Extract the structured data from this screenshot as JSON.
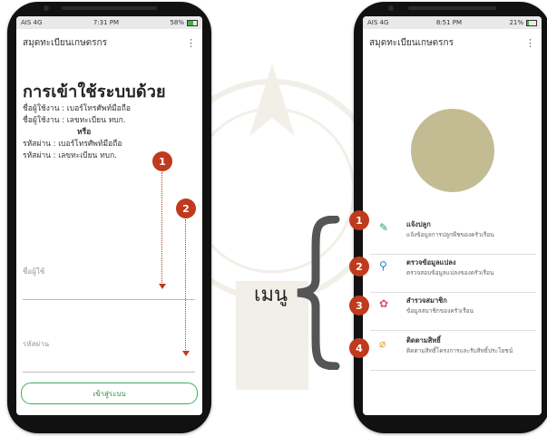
{
  "left_phone": {
    "status": {
      "carrier": "AIS 4G",
      "time": "7:31 PM",
      "battery": "58%",
      "battery_level": 0.58
    },
    "app_title": "สมุดทะเบียนเกษตรกร",
    "login_title": "การเข้าใช้ระบบด้วย",
    "info_lines": {
      "user1": "ชื่อผู้ใช้งาน : เบอร์โทรศัพท์มือถือ",
      "user2": "ชื่อผู้ใช้งาน : เลขทะเบียน ทบก.",
      "or": "หรือ",
      "pass1": "รหัสผ่าน : เบอร์โทรศัพท์มือถือ",
      "pass2": "รหัสผ่าน : เลขทะเบียน ทบก."
    },
    "username_label": "ชื่อผู้ใช้",
    "password_label": "รหัสผ่าน",
    "login_button": "เข้าสู่ระบบ",
    "badge1": "1",
    "badge2": "2"
  },
  "right_phone": {
    "status": {
      "carrier": "AIS 4G",
      "time": "8:51 PM",
      "battery": "21%",
      "battery_level": 0.21
    },
    "app_title": "สมุดทะเบียนเกษตรกร",
    "menu_items": [
      {
        "num": "1",
        "icon": "edit-icon",
        "title": "แจ้งปลูก",
        "subtitle": "แจ้งข้อมูลการปลูกพืชของครัวเรือน",
        "color": "#2e9e5b"
      },
      {
        "num": "2",
        "icon": "search-icon",
        "title": "ตรวจข้อมูลแปลง",
        "subtitle": "ตรวจสอบข้อมูลแปลงของครัวเรือน",
        "color": "#2a7fc9"
      },
      {
        "num": "3",
        "icon": "people-icon",
        "title": "สำรวจสมาชิก",
        "subtitle": "ข้อมูลสมาชิกของครัวเรือน",
        "color": "#d25a6e"
      },
      {
        "num": "4",
        "icon": "tag-icon",
        "title": "ติดตามสิทธิ์",
        "subtitle": "ติดตามสิทธิ์โครงการและรับสิทธิ์ประโยชน์",
        "color": "#e0a22e"
      }
    ]
  },
  "menu_label": "เมนู",
  "colors": {
    "badge": "#c03a1e",
    "button_border": "#3fae55",
    "avatar": "#c3bc93"
  }
}
